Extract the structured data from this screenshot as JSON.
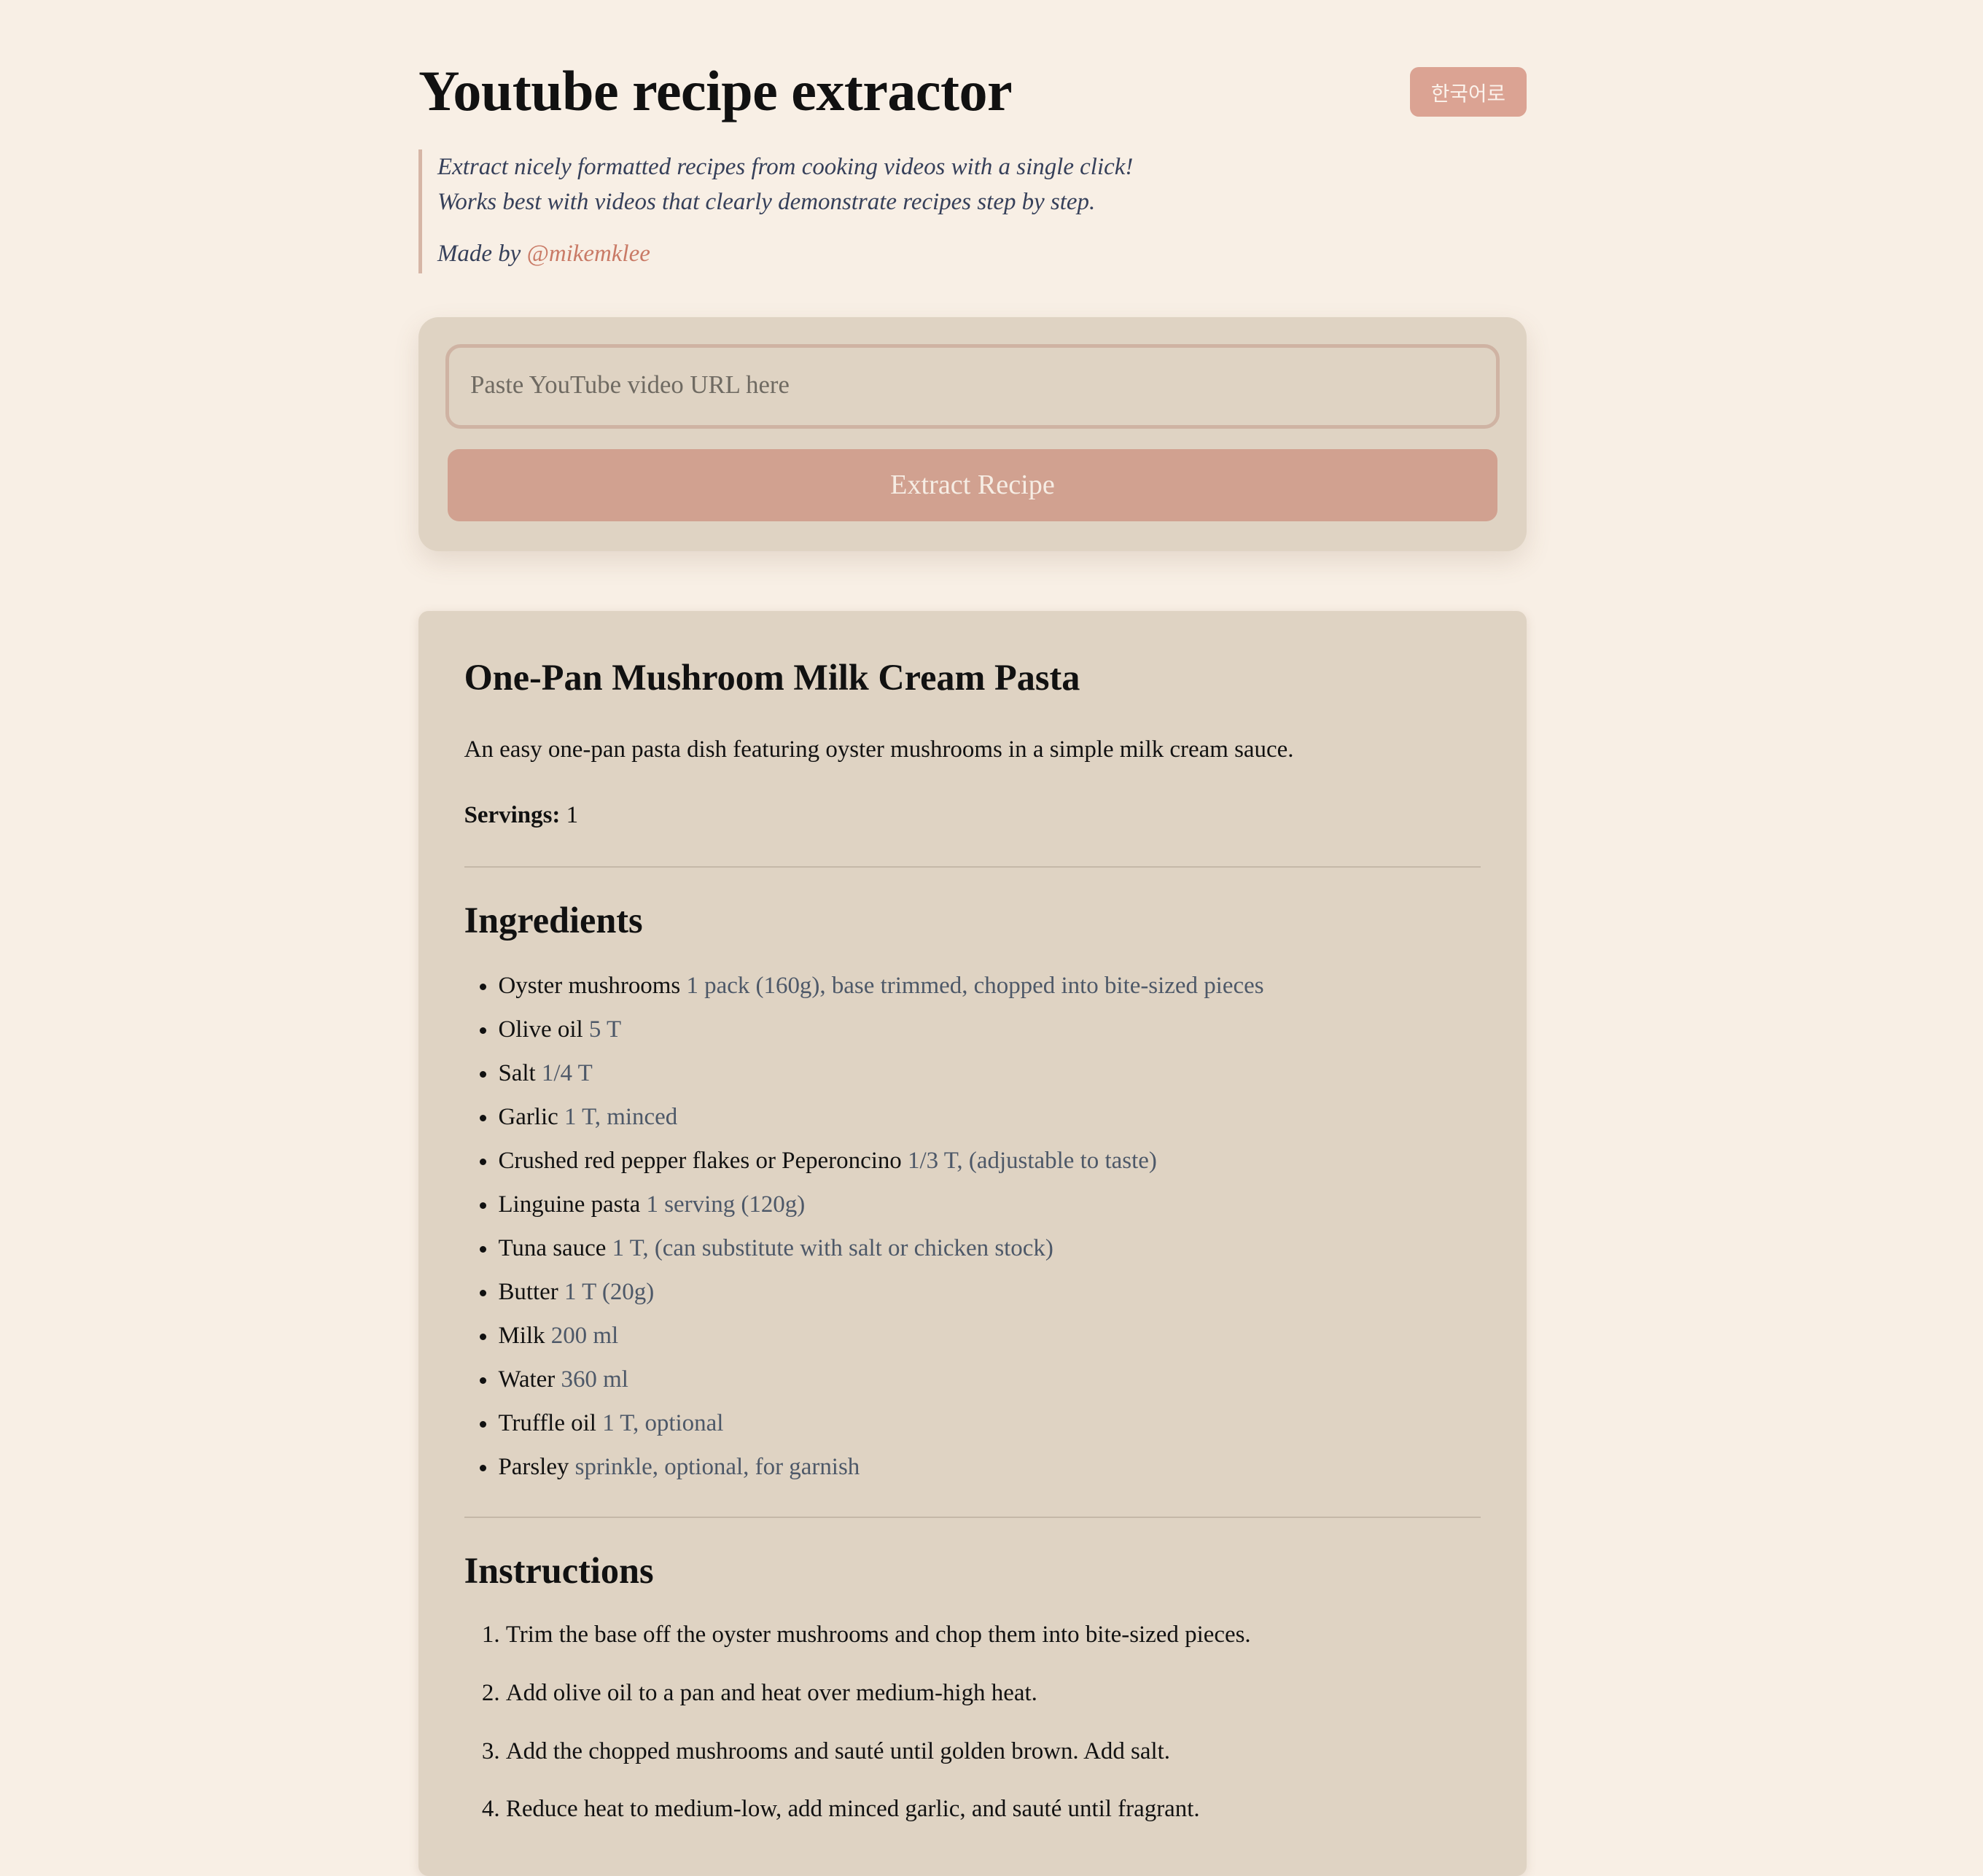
{
  "header": {
    "title": "Youtube recipe extractor",
    "language_button": "한국어로"
  },
  "intro": {
    "line1": "Extract nicely formatted recipes from cooking videos with a single click!",
    "line2": "Works best with videos that clearly demonstrate recipes step by step.",
    "made_by": "Made by",
    "author": "@mikemklee"
  },
  "form": {
    "url_placeholder": "Paste YouTube video URL here",
    "url_value": "",
    "submit_label": "Extract Recipe"
  },
  "recipe": {
    "title": "One-Pan Mushroom Milk Cream Pasta",
    "description": "An easy one-pan pasta dish featuring oyster mushrooms in a simple milk cream sauce.",
    "servings_label": "Servings:",
    "servings": "1",
    "ingredients_heading": "Ingredients",
    "ingredients": [
      {
        "name": "Oyster mushrooms",
        "amount": "1 pack (160g), base trimmed, chopped into bite-sized pieces"
      },
      {
        "name": "Olive oil",
        "amount": "5 T"
      },
      {
        "name": "Salt",
        "amount": "1/4 T"
      },
      {
        "name": "Garlic",
        "amount": "1 T, minced"
      },
      {
        "name": "Crushed red pepper flakes or Peperoncino",
        "amount": "1/3 T, (adjustable to taste)"
      },
      {
        "name": "Linguine pasta",
        "amount": "1 serving (120g)"
      },
      {
        "name": "Tuna sauce",
        "amount": "1 T, (can substitute with salt or chicken stock)"
      },
      {
        "name": "Butter",
        "amount": "1 T (20g)"
      },
      {
        "name": "Milk",
        "amount": "200 ml"
      },
      {
        "name": "Water",
        "amount": "360 ml"
      },
      {
        "name": "Truffle oil",
        "amount": "1 T, optional"
      },
      {
        "name": "Parsley",
        "amount": "sprinkle, optional, for garnish"
      }
    ],
    "instructions_heading": "Instructions",
    "instructions": [
      "Trim the base off the oyster mushrooms and chop them into bite-sized pieces.",
      "Add olive oil to a pan and heat over medium-high heat.",
      "Add the chopped mushrooms and sauté until golden brown. Add salt.",
      "Reduce heat to medium-low, add minced garlic, and sauté until fragrant."
    ]
  },
  "colors": {
    "background": "#f8efe5",
    "card": "#dfd3c3",
    "accent": "#d1a190",
    "link": "#c97a66"
  }
}
